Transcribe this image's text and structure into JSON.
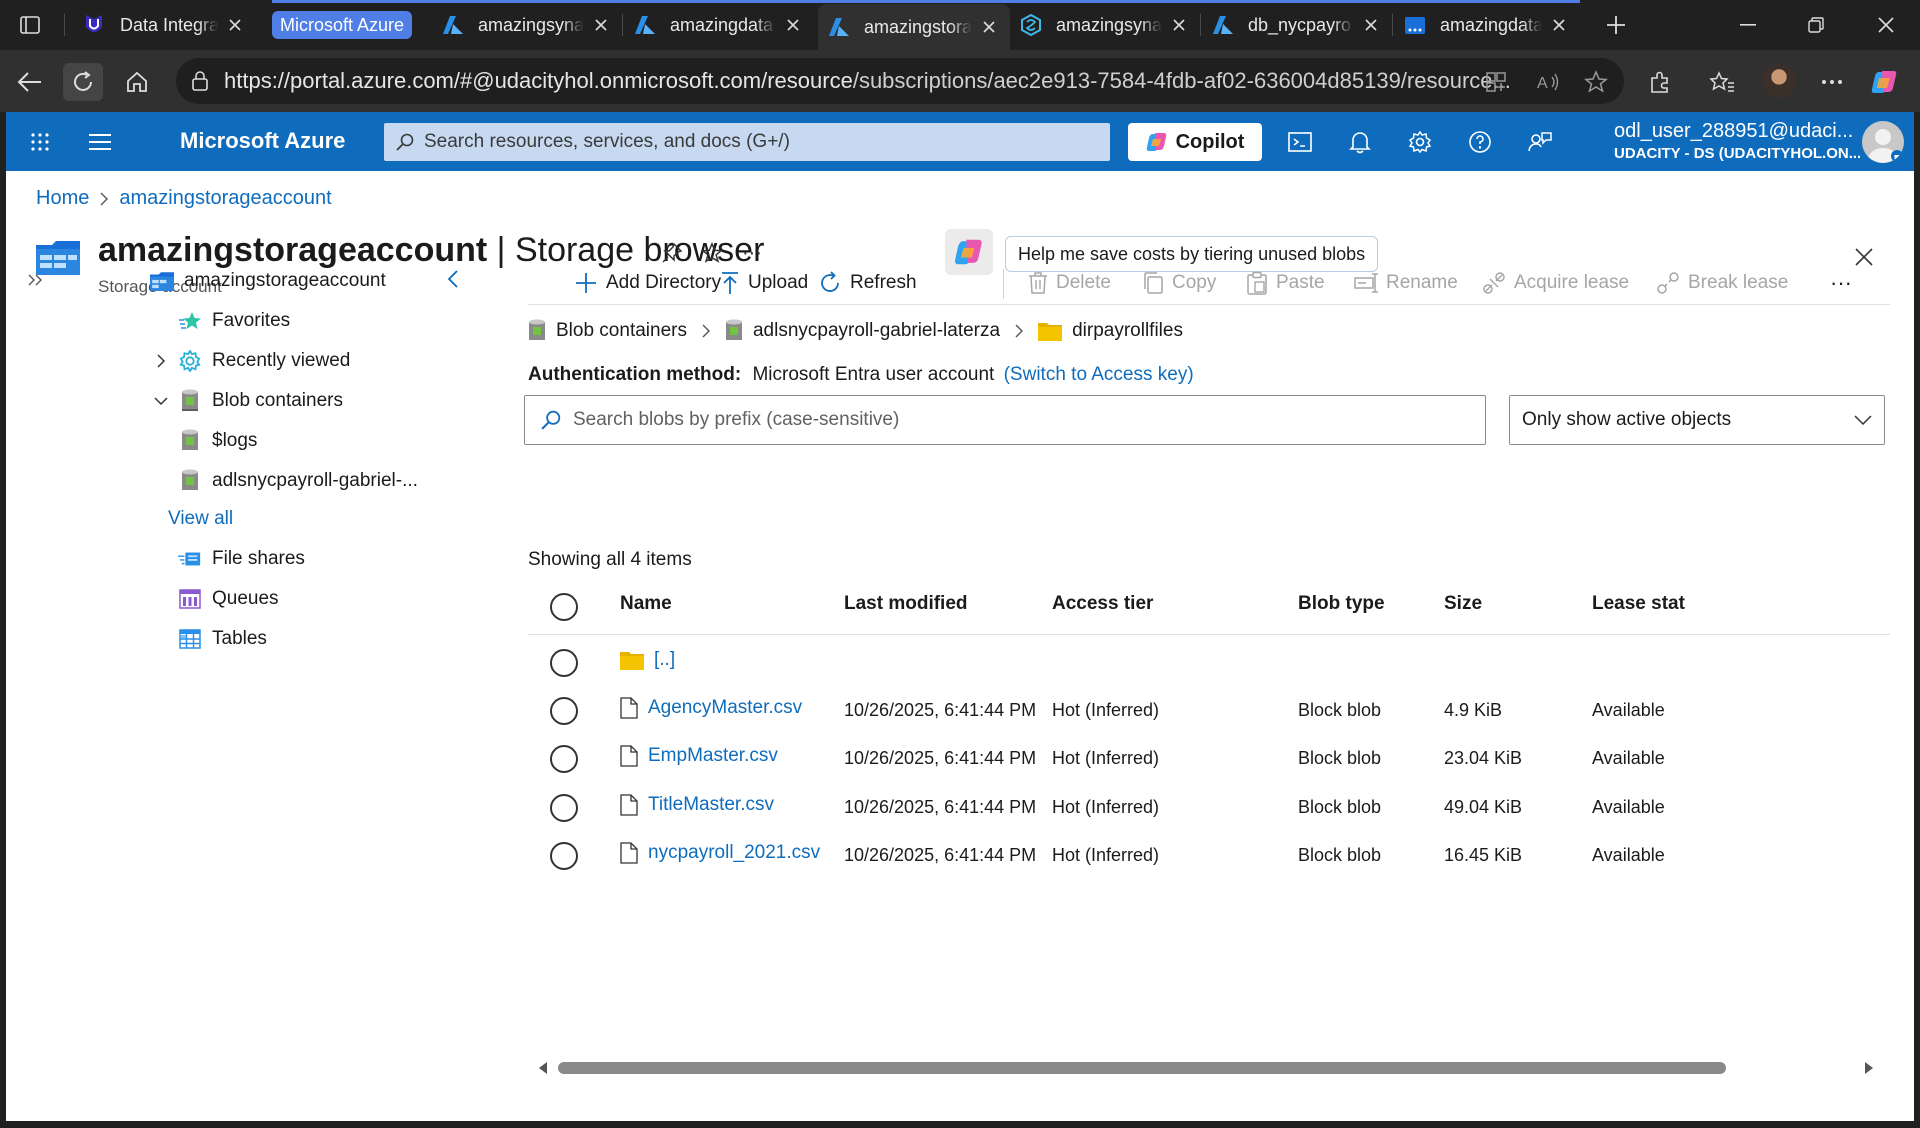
{
  "browser": {
    "tabs": [
      {
        "title": "Data Integrat",
        "icon": "udacity-icon"
      },
      {
        "title": "amazingsyna",
        "icon": "azure-icon"
      },
      {
        "title": "amazingdata",
        "icon": "azure-icon"
      },
      {
        "title": "amazingstora",
        "icon": "azure-icon"
      },
      {
        "title": "amazingsyna",
        "icon": "synapse-icon"
      },
      {
        "title": "db_nycpayro",
        "icon": "azure-icon"
      },
      {
        "title": "amazingdata",
        "icon": "datafactory-icon"
      }
    ],
    "tab_group_label": "Microsoft Azure",
    "url_main": "https://portal.azure.com/#@udacityhol.onmicrosoft.com/resource",
    "url_tail": "/subscriptions/aec2e913-7584-4fdb-af02-636004d85139/resource..."
  },
  "header": {
    "brand": "Microsoft Azure",
    "search_placeholder": "Search resources, services, and docs (G+/)",
    "copilot_label": "Copilot",
    "account_name": "odl_user_288951@udaci...",
    "account_directory": "UDACITY - DS (UDACITYHOL.ON..."
  },
  "breadcrumb": {
    "home": "Home",
    "resource": "amazingstorageaccount"
  },
  "page": {
    "title_resource": "amazingstorageaccount",
    "title_separator": " | ",
    "title_blade": "Storage browser",
    "subtitle": "Storage account",
    "more": "···",
    "cost_hint": "Help me save costs by tiering unused blobs"
  },
  "nav": {
    "root": "amazingstorageaccount",
    "favorites": "Favorites",
    "recently_viewed": "Recently viewed",
    "blob_containers": "Blob containers",
    "containers": [
      "$logs",
      "adlsnycpayroll-gabriel-..."
    ],
    "view_all": "View all",
    "file_shares": "File shares",
    "queues": "Queues",
    "tables": "Tables"
  },
  "commands": {
    "add_directory": "Add Directory",
    "upload": "Upload",
    "refresh": "Refresh",
    "delete": "Delete",
    "copy": "Copy",
    "paste": "Paste",
    "rename": "Rename",
    "acquire_lease": "Acquire lease",
    "break_lease": "Break lease",
    "more": "···"
  },
  "path": {
    "root": "Blob containers",
    "container": "adlsnycpayroll-gabriel-laterza",
    "directory": "dirpayrollfiles"
  },
  "auth": {
    "label": "Authentication method:",
    "value": "Microsoft Entra user account",
    "switch": "(Switch to Access key)"
  },
  "blob_search": {
    "placeholder": "Search blobs by prefix (case-sensitive)"
  },
  "filter": {
    "selected": "Only show active objects"
  },
  "count_text": "Showing all 4 items",
  "table": {
    "columns": [
      "Name",
      "Last modified",
      "Access tier",
      "Blob type",
      "Size",
      "Lease stat"
    ],
    "parent": "[..]",
    "rows": [
      {
        "name": "AgencyMaster.csv",
        "modified": "10/26/2025, 6:41:44 PM",
        "tier": "Hot (Inferred)",
        "type": "Block blob",
        "size": "4.9 KiB",
        "lease": "Available"
      },
      {
        "name": "EmpMaster.csv",
        "modified": "10/26/2025, 6:41:44 PM",
        "tier": "Hot (Inferred)",
        "type": "Block blob",
        "size": "23.04 KiB",
        "lease": "Available"
      },
      {
        "name": "TitleMaster.csv",
        "modified": "10/26/2025, 6:41:44 PM",
        "tier": "Hot (Inferred)",
        "type": "Block blob",
        "size": "49.04 KiB",
        "lease": "Available"
      },
      {
        "name": "nycpayroll_2021.csv",
        "modified": "10/26/2025, 6:41:44 PM",
        "tier": "Hot (Inferred)",
        "type": "Block blob",
        "size": "16.45 KiB",
        "lease": "Available"
      }
    ]
  },
  "colors": {
    "azure_blue": "#0f6cbd",
    "link": "#0f6cbd",
    "tab_group": "#4f7fe6",
    "folder": "#f5c400"
  }
}
